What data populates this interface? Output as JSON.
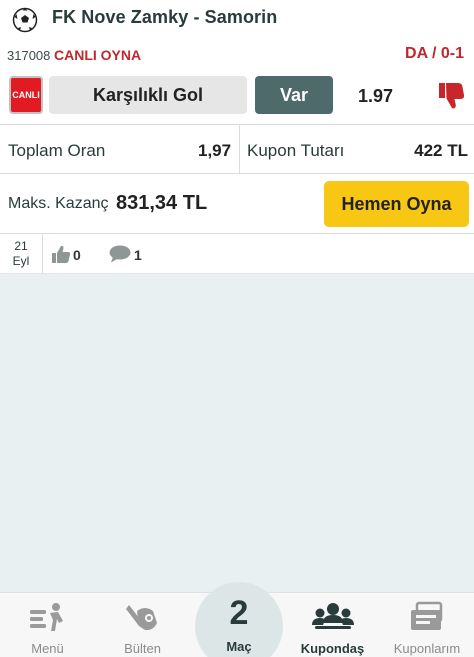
{
  "header": {
    "match_title": "FK Nove Zamky - Samorin",
    "match_code": "317008",
    "live_play_label": "CANLI OYNA",
    "result": "DA / 0-1"
  },
  "bet": {
    "live_badge": "CANLI",
    "market": "Karşılıklı Gol",
    "selection": "Var",
    "odd": "1.97",
    "dislike_icon": "thumbs-down-icon"
  },
  "totals": {
    "total_odds_label": "Toplam Oran",
    "total_odds_value": "1,97",
    "stake_label": "Kupon Tutarı",
    "stake_value": "422 TL"
  },
  "max_win": {
    "label": "Maks. Kazanç",
    "value": "831,34 TL",
    "play_button": "Hemen Oyna"
  },
  "social": {
    "date_day": "21",
    "date_month": "Eyl",
    "likes": "0",
    "comments": "1"
  },
  "colors": {
    "accent_red": "#c0282d",
    "selection_bg": "#4f6a6b",
    "play_button_bg": "#f7c713",
    "content_bg": "#e8f0f1"
  },
  "nav": {
    "menu": "Menü",
    "bulletin": "Bülten",
    "match_count": "2",
    "match_label": "Maç",
    "coupon_share": "Kupondaş",
    "my_coupons": "Kuponlarım"
  }
}
